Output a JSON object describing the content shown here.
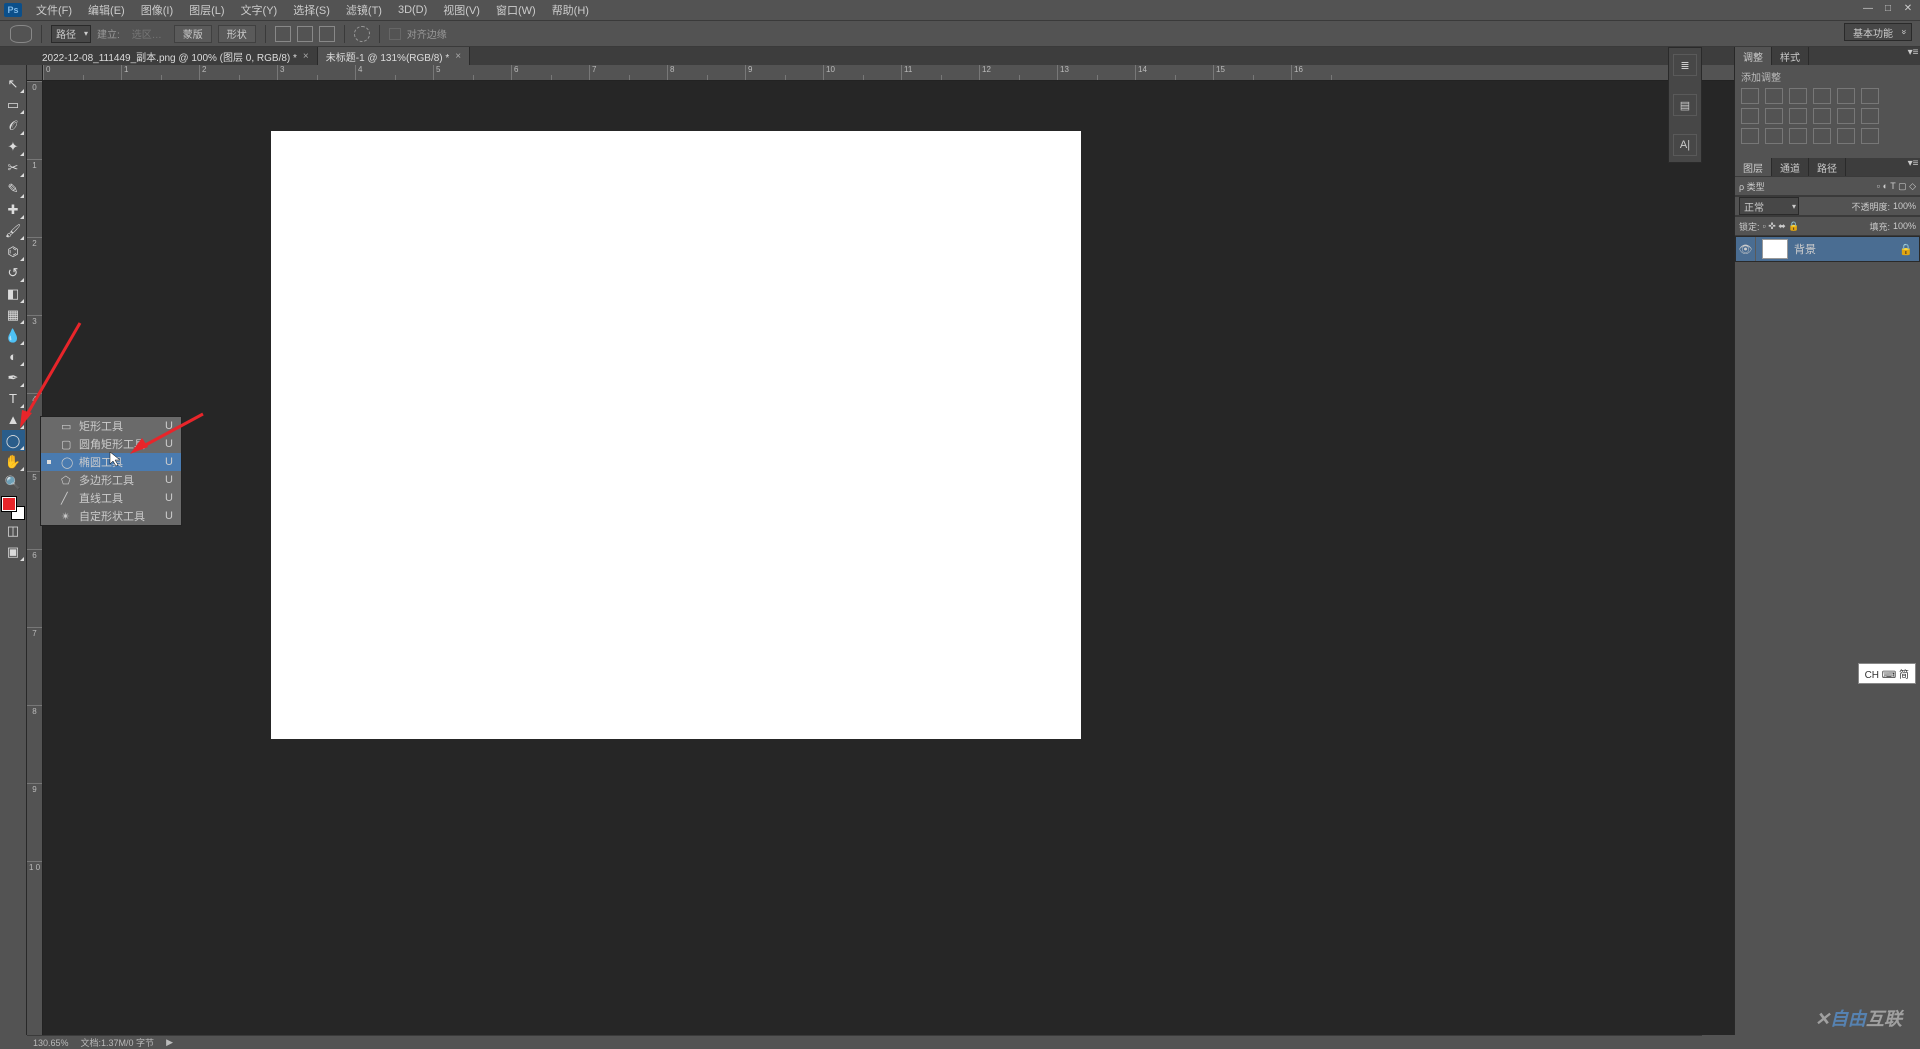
{
  "menubar": {
    "items": [
      "文件(F)",
      "编辑(E)",
      "图像(I)",
      "图层(L)",
      "文字(Y)",
      "选择(S)",
      "滤镜(T)",
      "3D(D)",
      "视图(V)",
      "窗口(W)",
      "帮助(H)"
    ]
  },
  "optbar": {
    "mode": "路径",
    "build": "建立:",
    "selbtn": "选区…",
    "mask": "蒙版",
    "shape": "形状",
    "align": "对齐边缘"
  },
  "workspace": "基本功能",
  "tabs": [
    {
      "label": "2022-12-08_111449_副本.png @ 100% (图层 0, RGB/8) *"
    },
    {
      "label": "未标题-1 @ 131%(RGB/8) *"
    }
  ],
  "hRuler": [
    "0",
    "1",
    "2",
    "3",
    "4",
    "5",
    "6",
    "7",
    "8",
    "9",
    "10",
    "11",
    "12",
    "13",
    "14",
    "15",
    "16"
  ],
  "vRuler": [
    "0",
    "1",
    "2",
    "3",
    "4",
    "5",
    "6",
    "7",
    "8",
    "9",
    "1 0"
  ],
  "flyout": [
    {
      "icon": "▭",
      "label": "矩形工具",
      "k": "U"
    },
    {
      "icon": "▢",
      "label": "圆角矩形工具",
      "k": "U"
    },
    {
      "icon": "◯",
      "label": "椭圆工具",
      "k": "U",
      "sel": true
    },
    {
      "icon": "⬠",
      "label": "多边形工具",
      "k": "U"
    },
    {
      "icon": "╱",
      "label": "直线工具",
      "k": "U"
    },
    {
      "icon": "✴",
      "label": "自定形状工具",
      "k": "U"
    }
  ],
  "adjust": {
    "tab1": "调整",
    "tab2": "样式",
    "title": "添加调整"
  },
  "layers": {
    "tab1": "图层",
    "tab2": "通道",
    "tab3": "路径",
    "kind": "ρ 类型",
    "blend": "正常",
    "opacity_l": "不透明度:",
    "opacity_v": "100%",
    "lock_l": "锁定:",
    "fill_l": "填充:",
    "fill_v": "100%",
    "bg": "背景"
  },
  "status": {
    "zoom": "130.65%",
    "doc": "文档:1.37M/0 字节"
  },
  "ime": "CH ⌨ 简",
  "wm1": "自由",
  "wm2": "互联"
}
